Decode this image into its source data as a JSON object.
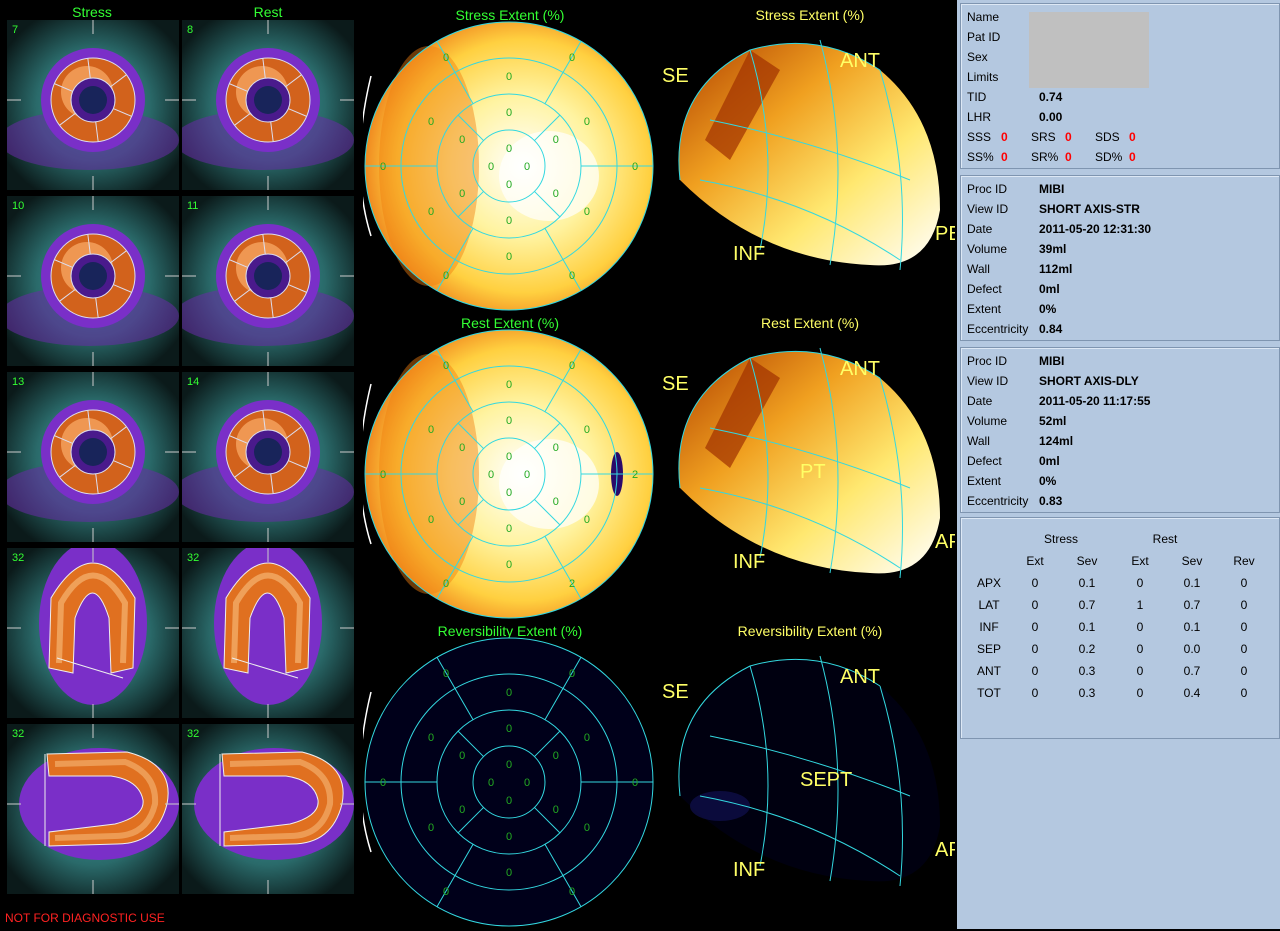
{
  "viewer": {
    "column_headers": {
      "stress": "Stress",
      "rest": "Rest"
    },
    "slices": [
      {
        "stress_num": "7",
        "rest_num": "8",
        "view": "short"
      },
      {
        "stress_num": "10",
        "rest_num": "11",
        "view": "short"
      },
      {
        "stress_num": "13",
        "rest_num": "14",
        "view": "short"
      },
      {
        "stress_num": "32",
        "rest_num": "32",
        "view": "vla"
      },
      {
        "stress_num": "32",
        "rest_num": "32",
        "view": "hla"
      }
    ],
    "polar_maps": [
      {
        "title": "Stress Extent (%)",
        "ring1": [
          "0",
          "0",
          "0",
          "0"
        ],
        "ring2": [
          "0",
          "0",
          "0",
          "0",
          "0",
          "0"
        ],
        "ring3": [
          "0",
          "0",
          "0",
          "0",
          "0",
          "0"
        ],
        "ring4": [
          "0",
          "0",
          "0",
          "0",
          "0",
          "0"
        ],
        "background": "yellow"
      },
      {
        "title": "Rest Extent (%)",
        "ring1": [
          "0",
          "0",
          "0",
          "0"
        ],
        "ring2": [
          "0",
          "0",
          "0",
          "0",
          "0",
          "0"
        ],
        "ring3": [
          "0",
          "0",
          "0",
          "0",
          "0",
          "0"
        ],
        "ring4": [
          "0",
          "2",
          "2",
          "0",
          "0",
          "0"
        ],
        "background": "yellow"
      },
      {
        "title": "Reversibility Extent (%)",
        "ring1": [
          "0",
          "0",
          "0",
          "0"
        ],
        "ring2": [
          "0",
          "0",
          "0",
          "0",
          "0",
          "0"
        ],
        "ring3": [
          "0",
          "0",
          "0",
          "0",
          "0",
          "0"
        ],
        "ring4": [
          "0",
          "0",
          "0",
          "0",
          "0",
          "0"
        ],
        "background": "dark"
      }
    ],
    "surface_views": [
      {
        "title": "Stress Extent (%)",
        "labels": {
          "top": "ANT",
          "bottom": "INF",
          "left": "SE",
          "right": "PE"
        }
      },
      {
        "title": "Rest Extent (%)",
        "labels": {
          "top": "ANT",
          "bottom": "INF",
          "left": "SE",
          "right": "AP",
          "center": "PT"
        }
      },
      {
        "title": "Reversibility Extent (%)",
        "labels": {
          "top": "ANT",
          "bottom": "INF",
          "left": "SE",
          "right": "AP",
          "center": "SEPT"
        }
      }
    ],
    "disclaimer": "NOT FOR DIAGNOSTIC USE"
  },
  "patient": {
    "name_label": "Name",
    "patid_label": "Pat ID",
    "sex_label": "Sex",
    "limits_label": "Limits",
    "tid_label": "TID",
    "tid": "0.74",
    "lhr_label": "LHR",
    "lhr": "0.00",
    "sss_label": "SSS",
    "sss": "0",
    "srs_label": "SRS",
    "srs": "0",
    "sds_label": "SDS",
    "sds": "0",
    "ssp_label": "SS%",
    "ssp": "0",
    "srp_label": "SR%",
    "srp": "0",
    "sdp_label": "SD%",
    "sdp": "0"
  },
  "studies": [
    {
      "proc_label": "Proc ID",
      "proc": "MIBI",
      "view_label": "View ID",
      "view": "SHORT AXIS-STR",
      "date_label": "Date",
      "date": "2011-05-20 12:31:30",
      "volume_label": "Volume",
      "volume": "39ml",
      "wall_label": "Wall",
      "wall": "112ml",
      "defect_label": "Defect",
      "defect": "0ml",
      "extent_label": "Extent",
      "extent": "0%",
      "ecc_label": "Eccentricity",
      "ecc": "0.84"
    },
    {
      "proc_label": "Proc ID",
      "proc": "MIBI",
      "view_label": "View ID",
      "view": "SHORT AXIS-DLY",
      "date_label": "Date",
      "date": "2011-05-20 11:17:55",
      "volume_label": "Volume",
      "volume": "52ml",
      "wall_label": "Wall",
      "wall": "124ml",
      "defect_label": "Defect",
      "defect": "0ml",
      "extent_label": "Extent",
      "extent": "0%",
      "ecc_label": "Eccentricity",
      "ecc": "0.83"
    }
  ],
  "segments": {
    "group_stress": "Stress",
    "group_rest": "Rest",
    "columns": [
      "",
      "Ext",
      "Sev",
      "Ext",
      "Sev",
      "Rev"
    ],
    "rows": [
      [
        "APX",
        "0",
        "0.1",
        "0",
        "0.1",
        "0"
      ],
      [
        "LAT",
        "0",
        "0.7",
        "1",
        "0.7",
        "0"
      ],
      [
        "INF",
        "0",
        "0.1",
        "0",
        "0.1",
        "0"
      ],
      [
        "SEP",
        "0",
        "0.2",
        "0",
        "0.0",
        "0"
      ],
      [
        "ANT",
        "0",
        "0.3",
        "0",
        "0.7",
        "0"
      ],
      [
        "TOT",
        "0",
        "0.3",
        "0",
        "0.4",
        "0"
      ]
    ]
  },
  "colors": {
    "panel_bg": "#b4c8e0",
    "abnormal_value": "#ff0000",
    "overlay": "#33e0e0",
    "label_green": "#33ff33"
  }
}
